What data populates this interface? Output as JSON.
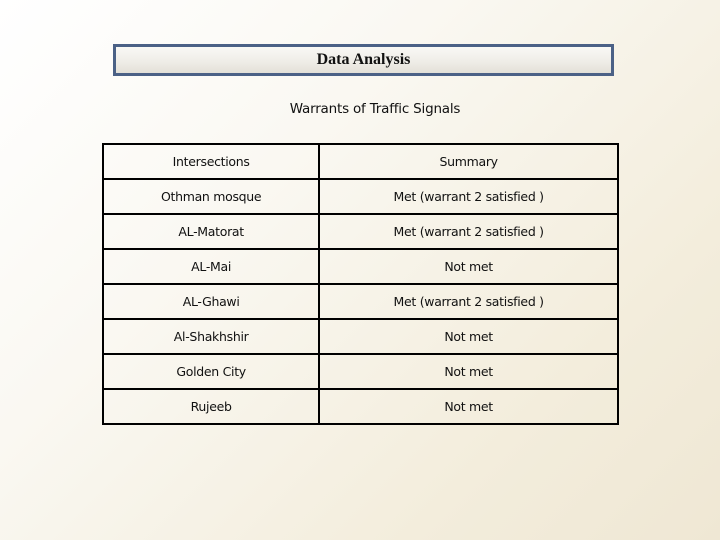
{
  "title": "Data Analysis",
  "subtitle": "Warrants of  Traffic Signals",
  "table": {
    "headers": [
      "Intersections",
      "Summary"
    ],
    "rows": [
      [
        "Othman mosque",
        "Met (warrant 2 satisfied )"
      ],
      [
        "AL-Matorat",
        "Met (warrant 2 satisfied )"
      ],
      [
        "AL-Mai",
        "Not met"
      ],
      [
        "AL-Ghawi",
        "Met (warrant 2 satisfied )"
      ],
      [
        "Al-Shakhshir",
        "Not met"
      ],
      [
        "Golden City",
        "Not met"
      ],
      [
        "Rujeeb",
        "Not met"
      ]
    ]
  },
  "colors": {
    "title_border": "#4b6186",
    "table_border": "#000000"
  }
}
